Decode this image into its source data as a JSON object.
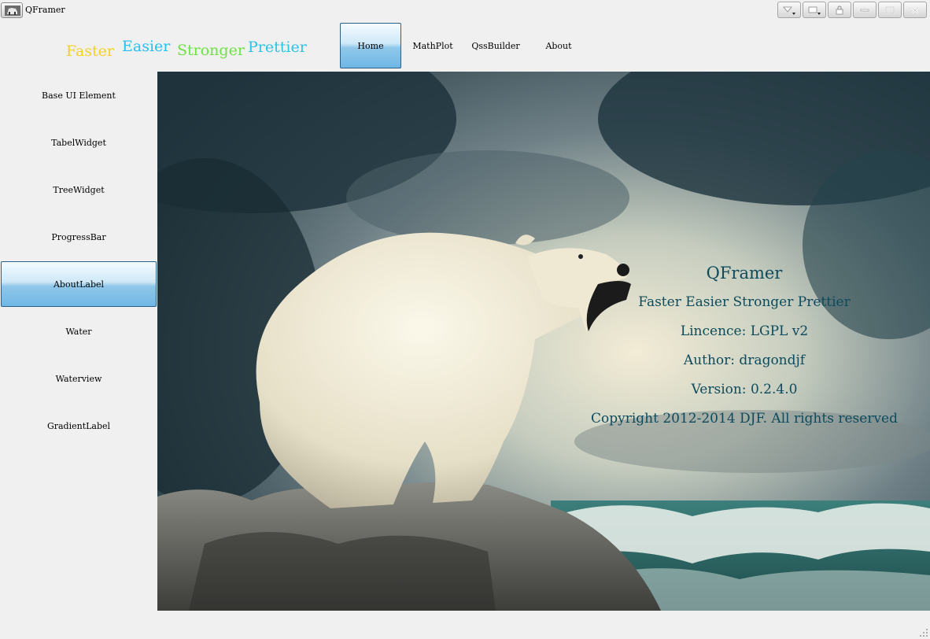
{
  "window": {
    "title": "QFramer",
    "app_icon": "bear-icon",
    "controls": [
      "skin-dropdown-icon",
      "settings-dropdown-icon",
      "lock-icon",
      "minimize-icon",
      "maximize-icon",
      "close-icon"
    ]
  },
  "slogan": {
    "words": [
      {
        "text": "Faster",
        "color": "#f3d21f"
      },
      {
        "text": "Easier",
        "color": "#25c0ef"
      },
      {
        "text": "Stronger",
        "color": "#6fe046"
      },
      {
        "text": "Prettier",
        "color": "#2cc2e6"
      }
    ]
  },
  "topnav": {
    "items": [
      {
        "label": "Home",
        "active": true
      },
      {
        "label": "MathPlot",
        "active": false
      },
      {
        "label": "QssBuilder",
        "active": false
      },
      {
        "label": "About",
        "active": false
      }
    ]
  },
  "sidebar": {
    "items": [
      {
        "label": "Base UI Element"
      },
      {
        "label": "TabelWidget"
      },
      {
        "label": "TreeWidget"
      },
      {
        "label": "ProgressBar"
      },
      {
        "label": "AboutLabel",
        "active": true
      },
      {
        "label": "Water"
      },
      {
        "label": "Waterview"
      },
      {
        "label": "GradientLabel"
      }
    ]
  },
  "about": {
    "lines": [
      "QFramer",
      "Faster Easier Stronger Prettier",
      "Lincence: LGPL v2",
      "Author: dragondjf",
      "Version: 0.2.4.0",
      "Copyright 2012-2014 DJF. All rights reserved"
    ],
    "text_color": "#0c4a5c"
  },
  "colors": {
    "accent_active_top": "#cfe8f7",
    "accent_active_bottom": "#6fb7e4",
    "border_active": "#2a5f86",
    "window_bg": "#f0f0f0"
  }
}
